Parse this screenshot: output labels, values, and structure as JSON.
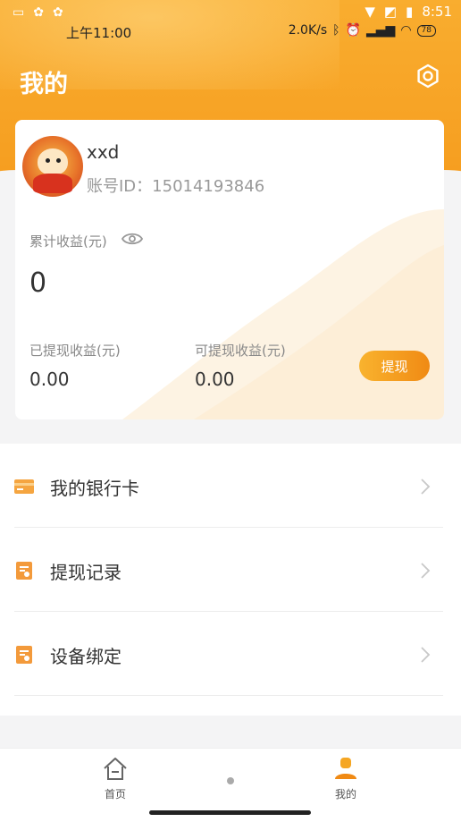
{
  "status_bar": {
    "time_top": "8:51",
    "time_left": "上午11:00",
    "network_speed": "2.0K/s",
    "battery": "78"
  },
  "header": {
    "title": "我的"
  },
  "profile": {
    "username": "xxd",
    "account_id": "账号ID：15014193846"
  },
  "earnings": {
    "total_label": "累计收益(元)",
    "total_value": "0",
    "withdrawn_label": "已提现收益(元)",
    "withdrawn_value": "0.00",
    "available_label": "可提现收益(元)",
    "available_value": "0.00",
    "withdraw_button": "提现"
  },
  "menu": {
    "items": [
      {
        "label": "我的银行卡",
        "icon": "bank-card-icon"
      },
      {
        "label": "提现记录",
        "icon": "withdraw-record-icon"
      },
      {
        "label": "设备绑定",
        "icon": "device-bind-icon"
      }
    ]
  },
  "bottom_nav": {
    "items": [
      {
        "label": "首页",
        "icon": "home-icon"
      },
      {
        "label": "我的",
        "icon": "profile-icon",
        "active": true
      }
    ]
  },
  "colors": {
    "accent": "#f59a1c",
    "icon_orange": "#f39a3b"
  }
}
